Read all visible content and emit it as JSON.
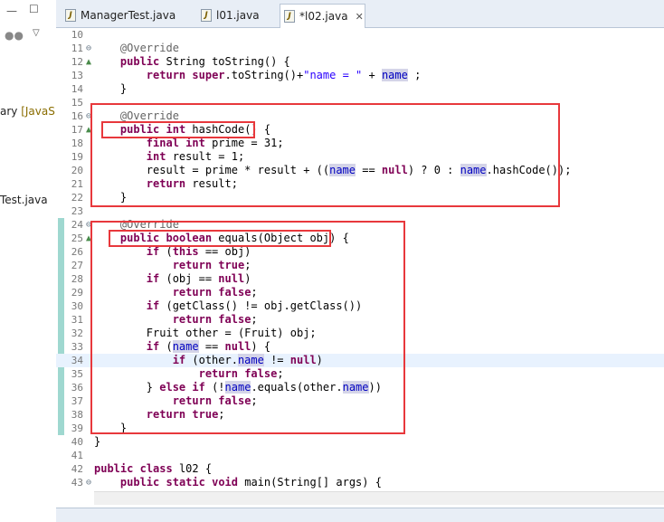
{
  "left_panel": {
    "items": [
      {
        "text": "ary ",
        "decoration": "[JavaS"
      },
      {
        "text": "Test.java",
        "decoration": ""
      }
    ]
  },
  "tabs": [
    {
      "label": "ManagerTest.java",
      "active": false,
      "closable": false
    },
    {
      "label": "l01.java",
      "active": false,
      "closable": false
    },
    {
      "label": "*l02.java",
      "active": true,
      "closable": true
    }
  ],
  "code": {
    "lines": [
      {
        "n": "10",
        "indicator": "",
        "bar": false,
        "text": ""
      },
      {
        "n": "11",
        "indicator": "⊖",
        "bar": false,
        "text": "    @Override"
      },
      {
        "n": "12",
        "indicator": "▲",
        "bar": false,
        "text": "    public String toString() {"
      },
      {
        "n": "13",
        "indicator": "",
        "bar": false,
        "text": "        return super.toString()+\"name = \" + name ;"
      },
      {
        "n": "14",
        "indicator": "",
        "bar": false,
        "text": "    }"
      },
      {
        "n": "15",
        "indicator": "",
        "bar": false,
        "text": ""
      },
      {
        "n": "16",
        "indicator": "⊖",
        "bar": false,
        "text": "    @Override"
      },
      {
        "n": "17",
        "indicator": "▲",
        "bar": false,
        "text": "    public int hashCode() {"
      },
      {
        "n": "18",
        "indicator": "",
        "bar": false,
        "text": "        final int prime = 31;"
      },
      {
        "n": "19",
        "indicator": "",
        "bar": false,
        "text": "        int result = 1;"
      },
      {
        "n": "20",
        "indicator": "",
        "bar": false,
        "text": "        result = prime * result + ((name == null) ? 0 : name.hashCode());"
      },
      {
        "n": "21",
        "indicator": "",
        "bar": false,
        "text": "        return result;"
      },
      {
        "n": "22",
        "indicator": "",
        "bar": false,
        "text": "    }"
      },
      {
        "n": "23",
        "indicator": "",
        "bar": false,
        "text": ""
      },
      {
        "n": "24",
        "indicator": "⊖",
        "bar": true,
        "text": "    @Override"
      },
      {
        "n": "25",
        "indicator": "▲",
        "bar": true,
        "text": "    public boolean equals(Object obj) {"
      },
      {
        "n": "26",
        "indicator": "",
        "bar": true,
        "text": "        if (this == obj)"
      },
      {
        "n": "27",
        "indicator": "",
        "bar": true,
        "text": "            return true;"
      },
      {
        "n": "28",
        "indicator": "",
        "bar": true,
        "text": "        if (obj == null)"
      },
      {
        "n": "29",
        "indicator": "",
        "bar": true,
        "text": "            return false;"
      },
      {
        "n": "30",
        "indicator": "",
        "bar": true,
        "text": "        if (getClass() != obj.getClass())"
      },
      {
        "n": "31",
        "indicator": "",
        "bar": true,
        "text": "            return false;"
      },
      {
        "n": "32",
        "indicator": "",
        "bar": true,
        "text": "        Fruit other = (Fruit) obj;"
      },
      {
        "n": "33",
        "indicator": "",
        "bar": true,
        "text": "        if (name == null) {"
      },
      {
        "n": "34",
        "indicator": "",
        "bar": true,
        "text": "            if (other.name != null)"
      },
      {
        "n": "35",
        "indicator": "",
        "bar": true,
        "text": "                return false;"
      },
      {
        "n": "36",
        "indicator": "",
        "bar": true,
        "text": "        } else if (!name.equals(other.name))"
      },
      {
        "n": "37",
        "indicator": "",
        "bar": true,
        "text": "            return false;"
      },
      {
        "n": "38",
        "indicator": "",
        "bar": true,
        "text": "        return true;"
      },
      {
        "n": "39",
        "indicator": "",
        "bar": true,
        "text": "    }"
      },
      {
        "n": "40",
        "indicator": "",
        "bar": false,
        "text": "}"
      },
      {
        "n": "41",
        "indicator": "",
        "bar": false,
        "text": ""
      },
      {
        "n": "42",
        "indicator": "",
        "bar": false,
        "text": "public class l02 {"
      },
      {
        "n": "43",
        "indicator": "⊖",
        "bar": false,
        "text": "    public static void main(String[] args) {"
      }
    ]
  },
  "colors": {
    "keyword": "#7f0055",
    "string": "#2a00ff",
    "annotation": "#646464",
    "field": "#0000c0",
    "highlight_box": "#e8383c"
  }
}
